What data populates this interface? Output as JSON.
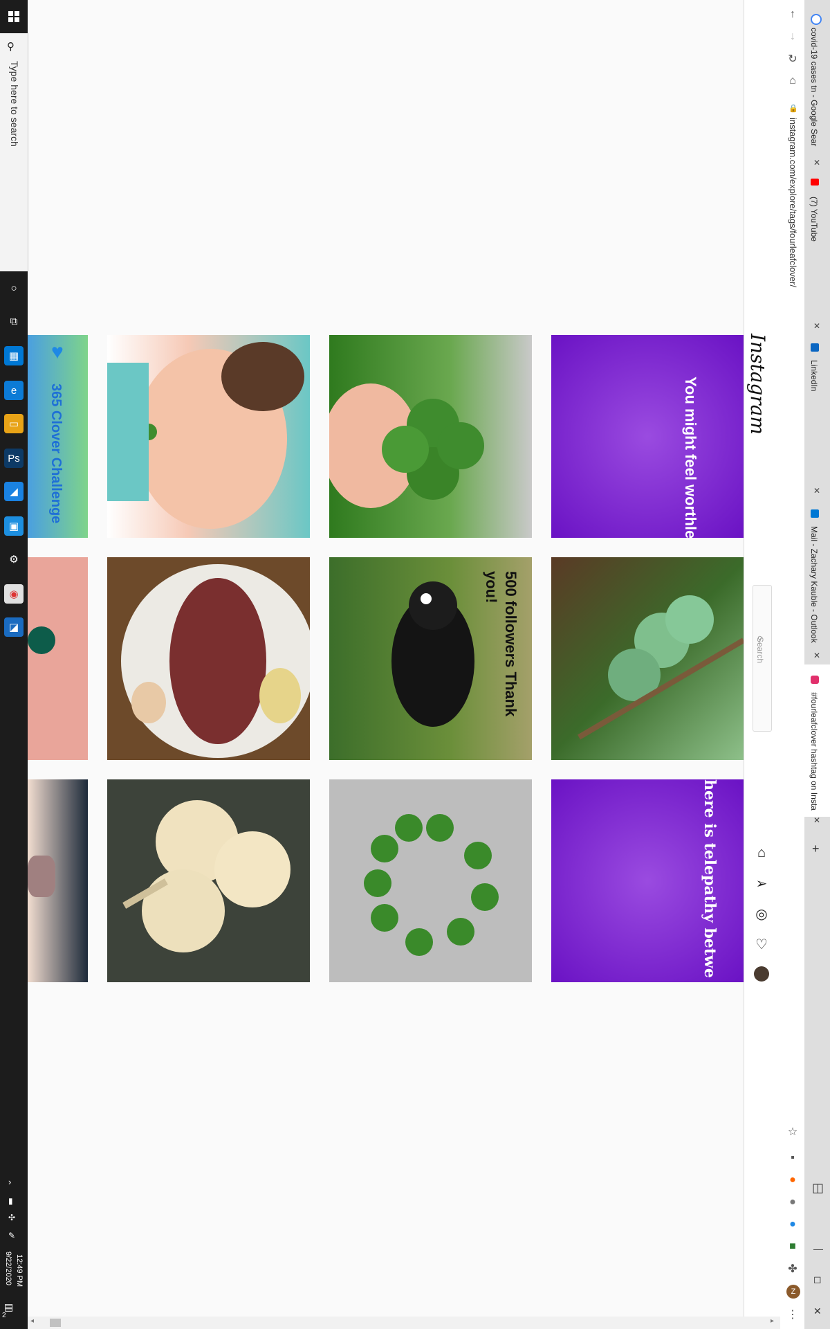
{
  "taskbar": {
    "search_placeholder": "Type here to search",
    "time": "12:49 PM",
    "date": "9/22/2020",
    "notification_count": "2"
  },
  "browser": {
    "tabs": [
      {
        "title": "covid-19 cases tn - Google Sear"
      },
      {
        "title": "(7) YouTube"
      },
      {
        "title": "LinkedIn"
      },
      {
        "title": "Mail - Zachary Kauble - Outlook"
      },
      {
        "title": "#fourleafclover hashtag on Insta"
      }
    ],
    "url": "instagram.com/explore/tags/fourleafclover/"
  },
  "instagram": {
    "logo": "Instagram",
    "search_placeholder": "Search",
    "posts": [
      {
        "caption": "You might feel worthless to one person but you are priceless to another. Don't ever forget your value."
      },
      {
        "caption": ""
      },
      {
        "caption": ""
      },
      {
        "caption": "365 Clover Challenge"
      },
      {
        "caption": ""
      },
      {
        "caption": "500 followers Thank you!"
      },
      {
        "caption": ""
      },
      {
        "caption": ""
      },
      {
        "caption": "here is telepathy betwe hearts."
      },
      {
        "caption": ""
      },
      {
        "caption": ""
      },
      {
        "caption": ""
      }
    ]
  },
  "colors": {
    "purple": "#7a1fd0",
    "clover_green": "#3f8c2e",
    "challenge_green": "#7fd48a"
  }
}
